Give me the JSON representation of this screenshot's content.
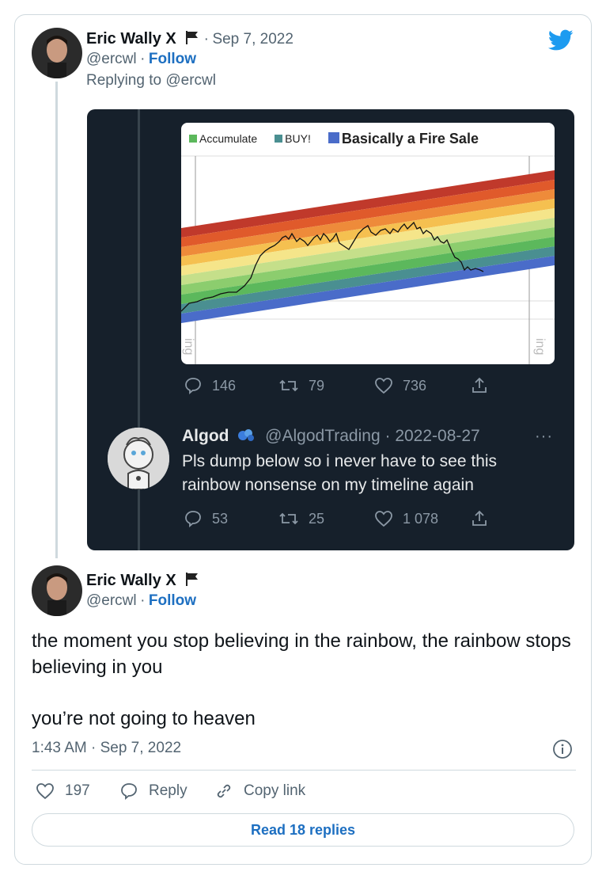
{
  "tweet1": {
    "author_name": "Eric Wally X",
    "separator": "·",
    "date": "Sep 7, 2022",
    "handle": "@ercwl",
    "follow_sep": "·",
    "follow": "Follow",
    "replying": "Replying to @ercwl"
  },
  "embed": {
    "chart_legend": [
      {
        "label": "Accumulate",
        "color": "#5cb85c"
      },
      {
        "label": "BUY!",
        "color": "#4a8f91"
      },
      {
        "label": "Basically a Fire Sale",
        "color": "#4a6cc9"
      }
    ],
    "chart_watermark_left": "ing",
    "chart_watermark_right": "ing",
    "actions": {
      "replies": "146",
      "retweets": "79",
      "likes": "736"
    },
    "quoted": {
      "name": "Algod",
      "handle": "@AlgodTrading",
      "date": "2022-08-27",
      "text": "Pls dump below so i never have to see this rainbow nonsense on my timeline again",
      "actions": {
        "replies": "53",
        "retweets": "25",
        "likes": "1 078"
      }
    }
  },
  "tweet2": {
    "author_name": "Eric Wally X",
    "handle": "@ercwl",
    "follow_sep": "·",
    "follow": "Follow",
    "text_line1": "the moment you stop believing in the rainbow, the rainbow stops believing in you",
    "text_line2": "you’re not going to heaven",
    "timestamp": "1:43 AM · Sep 7, 2022",
    "likes": "197",
    "reply_label": "Reply",
    "copy_label": "Copy link",
    "read_replies": "Read 18 replies"
  },
  "colors": {
    "twitter_blue": "#1d9bf0",
    "link_blue": "#1d6fc1"
  },
  "icons": [
    "twitter-bird-icon",
    "flag-icon",
    "reply-icon",
    "retweet-icon",
    "like-icon",
    "share-icon",
    "info-icon",
    "link-icon",
    "more-icon",
    "verified-badge-icon"
  ]
}
